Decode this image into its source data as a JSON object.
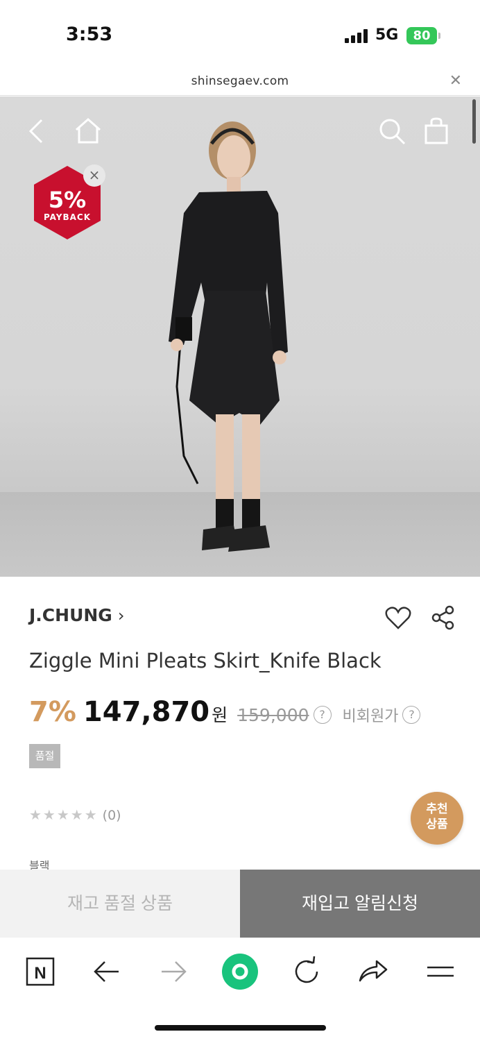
{
  "status_bar": {
    "time": "3:53",
    "network": "5G",
    "battery": "80"
  },
  "browser": {
    "url": "shinsegaev.com"
  },
  "hero": {
    "payback_percent": "5%",
    "payback_label": "PAYBACK"
  },
  "product": {
    "brand": "J.CHUNG",
    "title": "Ziggle Mini Pleats Skirt_Knife Black",
    "discount": "7%",
    "price": "147,870",
    "currency": "원",
    "original_price": "159,000",
    "question_mark": "?",
    "member_price_label": "비회원가",
    "soldout_badge": "품절",
    "rating_stars": "★★★★★",
    "rating_count": "(0)",
    "recommend_line1": "추천",
    "recommend_line2": "상품",
    "color": "블랙"
  },
  "actions": {
    "soldout_label": "재고 품절 상품",
    "restock_label": "재입고 알림신청"
  },
  "colors": {
    "accent": "#d39a5e",
    "payback": "#c8102e",
    "active_green": "#19c37d"
  },
  "toolbar": {
    "naver_label": "N"
  }
}
